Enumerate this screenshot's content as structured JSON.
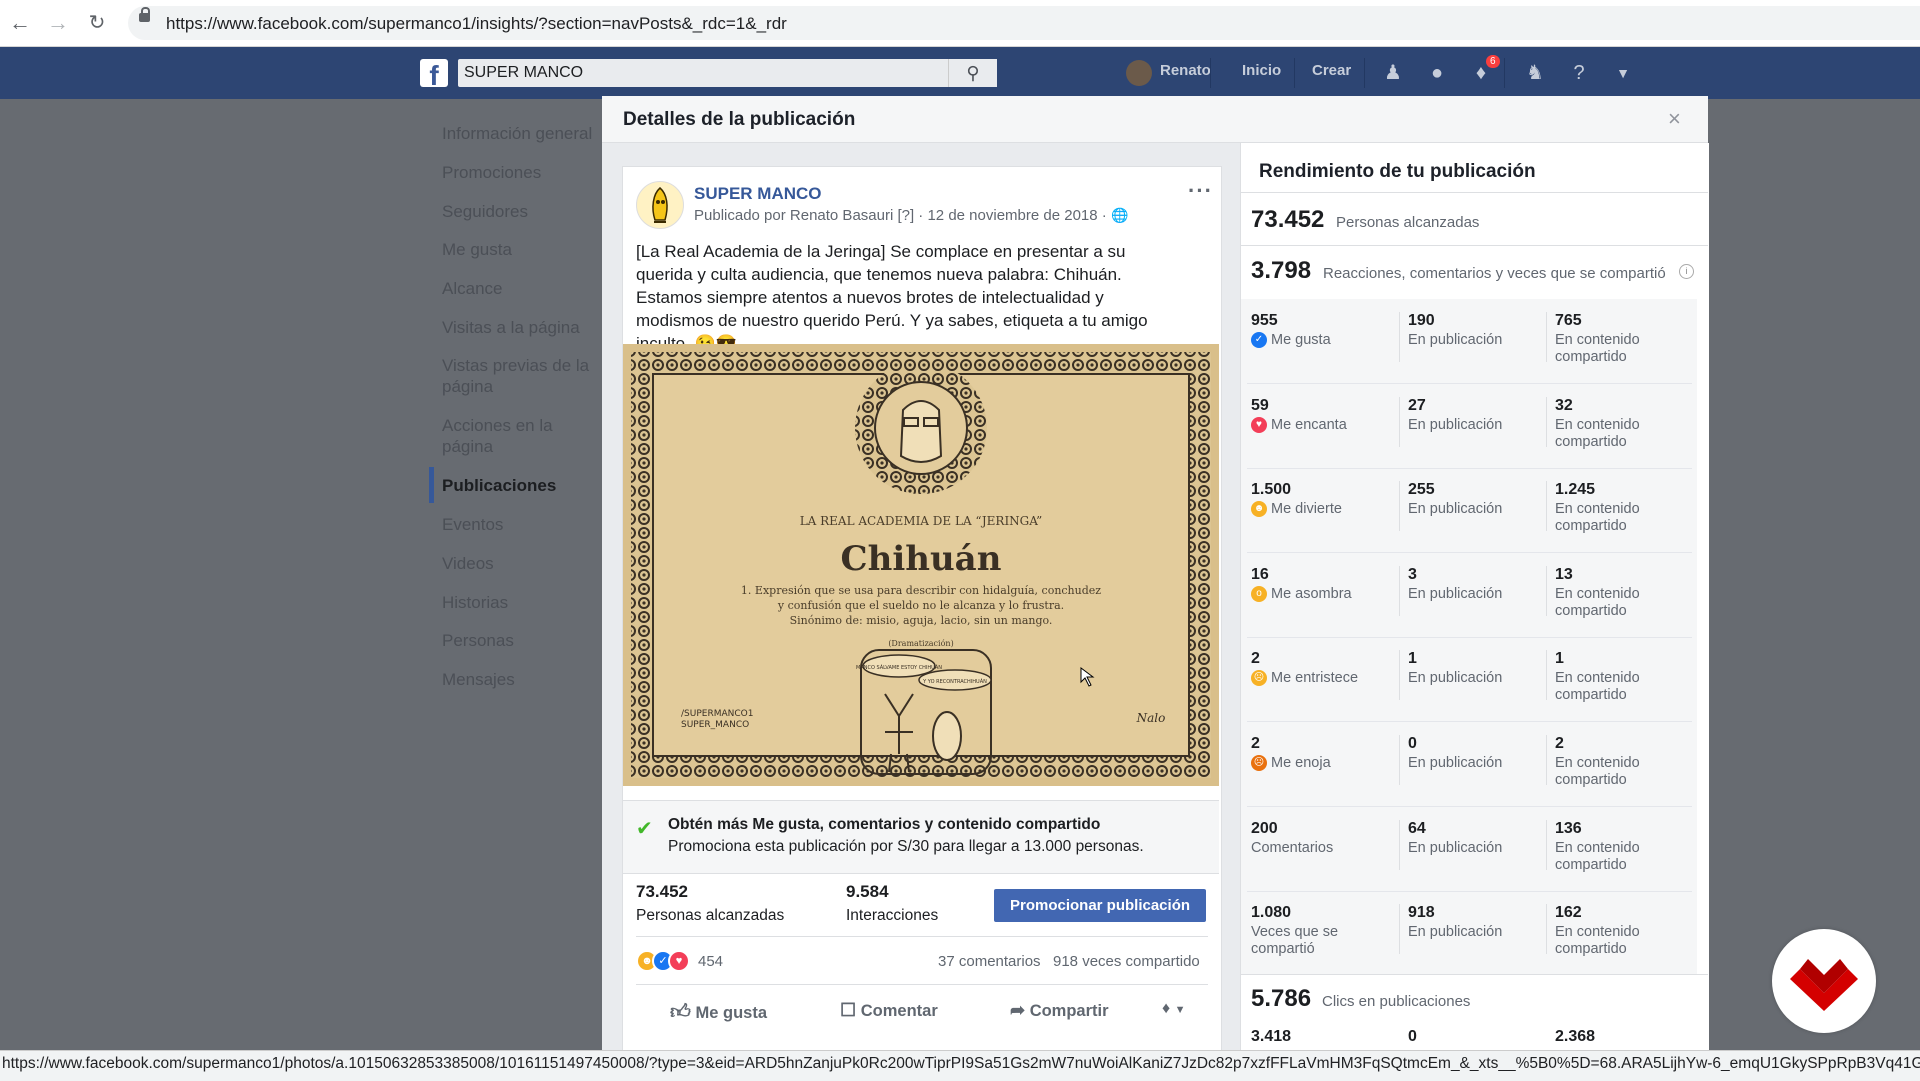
{
  "browser": {
    "url": "https://www.facebook.com/supermanco1/insights/?section=navPosts&_rdc=1&_rdr",
    "status_url": "https://www.facebook.com/supermanco1/photos/a.10150632853385008/10161151497450008/?type=3&eid=ARD5hnZanjuPk0Rc200wTiprPI9Sa51Gs2mW7nuWoiAlKaniZ7JzDc82p7xzfFFLaVmHM3FqSQtmcEm_&_xts__%5B0%5D=68.ARA5LijhYw-6_emqU1GkySPpRpB3Vq41GmA2n"
  },
  "fbbar": {
    "search_value": "SUPER MANCO",
    "user": "Renato",
    "home": "Inicio",
    "create": "Crear",
    "notif_count": "6"
  },
  "menu": {
    "items": [
      "Información general",
      "Promociones",
      "Seguidores",
      "Me gusta",
      "Alcance",
      "Visitas a la página",
      "Vistas previas de la página",
      "Acciones en la página",
      "Publicaciones",
      "Eventos",
      "Videos",
      "Historias",
      "Personas",
      "Mensajes"
    ],
    "active": "Publicaciones"
  },
  "modal": {
    "title": "Detalles de la publicación",
    "close": "×"
  },
  "post": {
    "page_name": "SUPER MANCO",
    "meta": "Publicado por Renato Basauri [?] · 12 de noviembre de 2018 · ",
    "text": "[La Real Academia de la Jeringa] Se complace en presentar a su querida y culta audiencia, que tenemos nueva palabra: Chihuán. Estamos siempre atentos a nuevos brotes de intelectualidad y modismos de nuestro querido Perú. Y ya sabes, etiqueta a tu amigo inculto. 😉😎",
    "image": {
      "academy": "LA REAL ACADEMIA DE LA “JERINGA”",
      "word": "Chihuán",
      "def1": "1. Expresión que se usa para describir con hidalguía, conchudez",
      "def2": "y confusión que el sueldo no le alcanza y lo frustra.",
      "def3": "Sinónimo de: misio, aguja, lacio, sin un mango.",
      "dramatizacion": "(Dramatización)",
      "bubble1": "MANCO SÁLVAME ESTOY CHIHUÁN",
      "bubble2": "Y YO RECONTRACHIHUÁN",
      "credit1": "/SUPERMANCO1",
      "credit2": "SUPER_MANCO",
      "signature": "Nalo"
    },
    "promo_title": "Obtén más Me gusta, comentarios y contenido compartido",
    "promo_text": "Promociona esta publicación por S/30 para llegar a 13.000 personas.",
    "reach_value": "73.452",
    "reach_label": "Personas alcanzadas",
    "interactions_value": "9.584",
    "interactions_label": "Interacciones",
    "promote_button": "Promocionar publicación",
    "reaction_count": "454",
    "comments": "37 comentarios",
    "shares": "918 veces compartido",
    "like": "Me gusta",
    "comment": "Comentar",
    "share": "Compartir"
  },
  "insights": {
    "title": "Rendimiento de tu publicación",
    "reach_value": "73.452",
    "reach_label": "Personas alcanzadas",
    "engagement_value": "3.798",
    "engagement_label": "Reacciones, comentarios y veces que se compartió",
    "on_post": "En publicación",
    "on_shared_1": "En contenido",
    "on_shared_2": "compartido",
    "rows": [
      {
        "value": "955",
        "label": "Me gusta",
        "icon": "like",
        "post": "190",
        "shared": "765"
      },
      {
        "value": "59",
        "label": "Me encanta",
        "icon": "love",
        "post": "27",
        "shared": "32"
      },
      {
        "value": "1.500",
        "label": "Me divierte",
        "icon": "haha",
        "post": "255",
        "shared": "1.245"
      },
      {
        "value": "16",
        "label": "Me asombra",
        "icon": "wow",
        "post": "3",
        "shared": "13"
      },
      {
        "value": "2",
        "label": "Me entristece",
        "icon": "sad",
        "post": "1",
        "shared": "1"
      },
      {
        "value": "2",
        "label": "Me enoja",
        "icon": "angry",
        "post": "0",
        "shared": "2"
      },
      {
        "value": "200",
        "label": "Comentarios",
        "icon": "",
        "post": "64",
        "shared": "136"
      },
      {
        "value": "1.080",
        "label": "Veces que se compartió",
        "icon": "",
        "post": "918",
        "shared": "162"
      }
    ],
    "clicks_value": "5.786",
    "clicks_label": "Clics en publicaciones",
    "last_value": "3.418",
    "last_post": "0",
    "last_shared": "2.368"
  },
  "colors": {
    "fb_blue": "#2d4573",
    "link_blue": "#365899",
    "button_blue": "#4267b2",
    "red_logo": "#d40000"
  }
}
